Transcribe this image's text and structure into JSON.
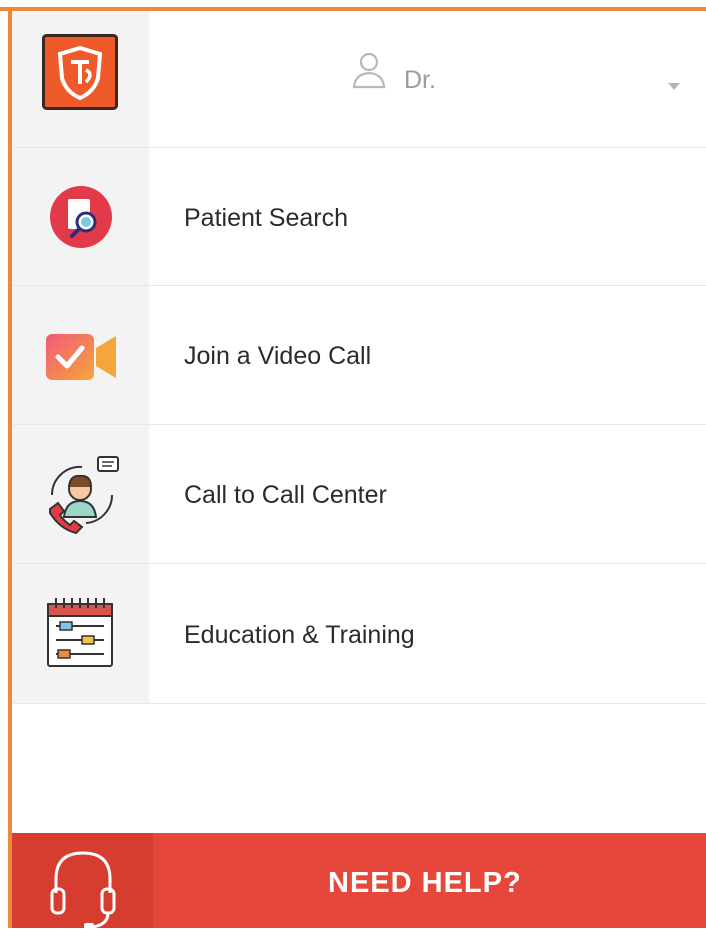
{
  "header": {
    "logo_text": "TL",
    "user_label": "Dr.",
    "user_icon": "person-outline-icon",
    "dropdown_icon": "caret-down-icon"
  },
  "menu": {
    "items": [
      {
        "label": "Patient Search",
        "icon": "patient-search-icon"
      },
      {
        "label": "Join a Video Call",
        "icon": "video-call-icon"
      },
      {
        "label": "Call to Call Center",
        "icon": "call-center-agent-icon"
      },
      {
        "label": "Education & Training",
        "icon": "training-calendar-icon"
      }
    ]
  },
  "help": {
    "label": "NEED HELP?",
    "icon": "headset-icon"
  },
  "colors": {
    "accent_orange": "#f0883a",
    "help_red": "#e5473b",
    "help_icon_red": "#d63d2f",
    "sidebar_gray": "#f3f3f3"
  }
}
